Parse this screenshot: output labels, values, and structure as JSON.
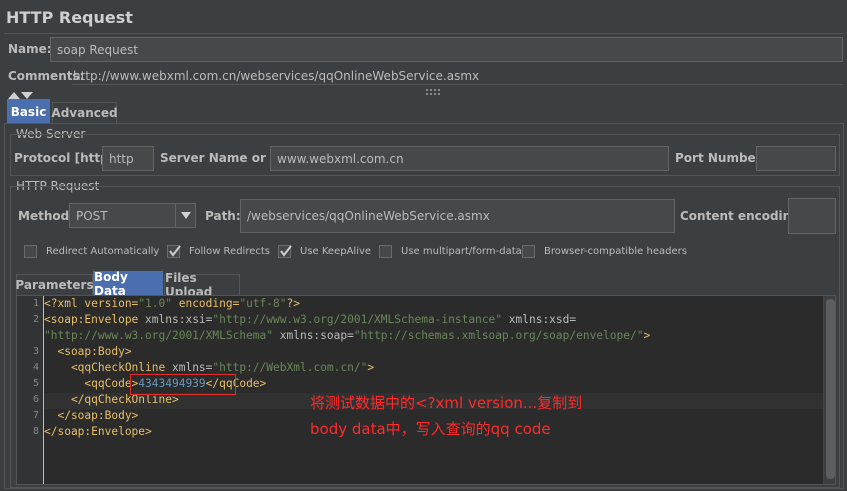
{
  "title": "HTTP Request",
  "name": {
    "label": "Name:",
    "value": "soap Request"
  },
  "comments": {
    "label": "Comments:",
    "value": "http://www.webxml.com.cn/webservices/qqOnlineWebService.asmx"
  },
  "tabs": [
    {
      "label": "Basic",
      "active": true
    },
    {
      "label": "Advanced",
      "active": false
    }
  ],
  "web_server": {
    "title": "Web Server",
    "protocol_label": "Protocol [http]:",
    "protocol_value": "http",
    "server_label": "Server Name or IP:",
    "server_value": "www.webxml.com.cn",
    "port_label": "Port Number:",
    "port_value": ""
  },
  "http_request": {
    "title": "HTTP Request",
    "method_label": "Method:",
    "method_value": "POST",
    "path_label": "Path:",
    "path_value": "/webservices/qqOnlineWebService.asmx",
    "encoding_label": "Content encoding:",
    "encoding_value": ""
  },
  "checkboxes": [
    {
      "label": "Redirect Automatically",
      "checked": false
    },
    {
      "label": "Follow Redirects",
      "checked": true
    },
    {
      "label": "Use KeepAlive",
      "checked": true
    },
    {
      "label": "Use multipart/form-data",
      "checked": false
    },
    {
      "label": "Browser-compatible headers",
      "checked": false
    }
  ],
  "subtabs": [
    {
      "label": "Parameters",
      "active": false
    },
    {
      "label": "Body Data",
      "active": true
    },
    {
      "label": "Files Upload",
      "active": false
    }
  ],
  "code": {
    "line_numbers": [
      "1",
      "2",
      "",
      "3",
      "4",
      "5",
      "6",
      "7",
      "8"
    ],
    "l1a": "<?xml version=",
    "l1b": "\"1.0\"",
    "l1c": " encoding=",
    "l1d": "\"utf-8\"",
    "l1e": "?>",
    "l2a": "<soap:Envelope ",
    "l2b": "xmlns:xsi=",
    "l2c": "\"http://www.w3.org/2001/XMLSchema-instance\"",
    "l2d": " xmlns:xsd=",
    "l2e": "\"http://www.w3.org/2001/XMLSchema\"",
    "l2f": " xmlns:soap=",
    "l2g": "\"http://schemas.xmlsoap.org/soap/envelope/\"",
    "l2h": ">",
    "l3": "  <soap:Body>",
    "l4a": "    <qqCheckOnline ",
    "l4b": "xmlns=",
    "l4c": "\"http://WebXml.com.cn/\"",
    "l4d": ">",
    "l5a": "      <qqCode>",
    "l5b": "4343494939",
    "l5c": "</qqCode>",
    "l6": "    </qqCheckOnline>",
    "l7": "  </soap:Body>",
    "l8": "</soap:Envelope>"
  },
  "annotation": {
    "line1": "将测试数据中的<?xml version...复制到",
    "line2": "body data中，写入查询的qq code",
    "color": "#ff2a2a"
  }
}
